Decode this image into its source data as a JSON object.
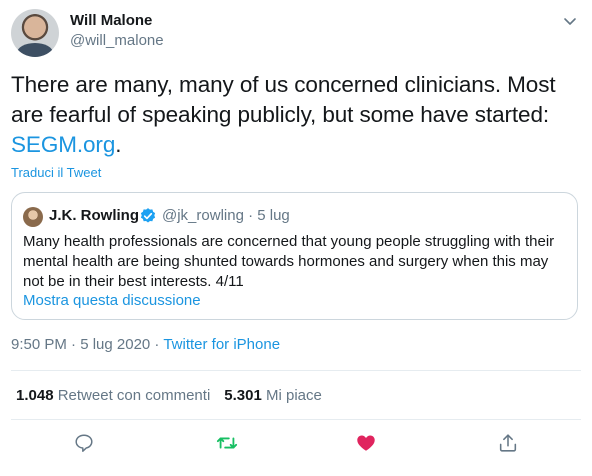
{
  "author": {
    "name": "Will Malone",
    "handle": "@will_malone"
  },
  "tweet": {
    "text_before_link": "There are many, many of us concerned clinicians. Most are fearful of speaking publicly, but some have started: ",
    "link": "SEGM.org",
    "text_after_link": ".",
    "translate_label": "Traduci il Tweet"
  },
  "quote": {
    "name": "J.K. Rowling",
    "handle": "@jk_rowling",
    "date": " · 5 lug",
    "text": "Many health professionals are concerned that young people struggling with their mental health are being shunted towards hormones and surgery when this may not be in their best interests. 4/11",
    "show_thread": "Mostra questa discussione"
  },
  "meta": {
    "time_date": "9:50 PM · 5 lug 2020 · ",
    "client": "Twitter for iPhone"
  },
  "stats": {
    "retweets_count": "1.048",
    "retweets_label": " Retweet con commenti",
    "likes_count": "5.301",
    "likes_label": " Mi piace"
  },
  "icons": {
    "caret": "chevron-down-icon",
    "reply": "reply-icon",
    "retweet": "retweet-icon",
    "like": "heart-icon",
    "share": "share-icon",
    "verified": "verified-badge-icon"
  },
  "colors": {
    "link": "#1b95e0",
    "retweet_active": "#17bf63",
    "like_active": "#e0245e",
    "muted": "#657786",
    "text": "#14171a"
  }
}
